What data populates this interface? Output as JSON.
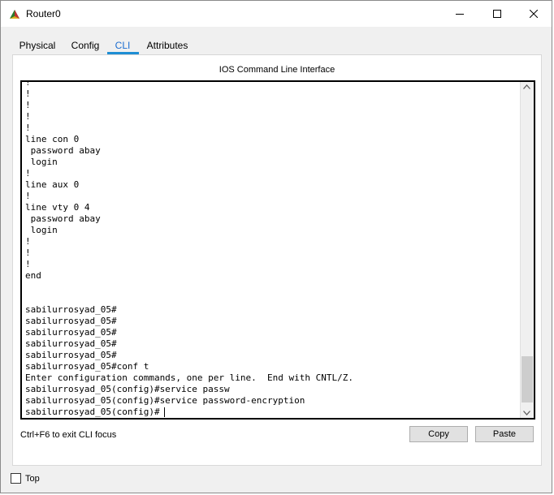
{
  "window": {
    "title": "Router0"
  },
  "tabs": [
    {
      "label": "Physical"
    },
    {
      "label": "Config"
    },
    {
      "label": "CLI",
      "active": true
    },
    {
      "label": "Attributes"
    }
  ],
  "cli": {
    "panel_title": "IOS Command Line Interface",
    "lines": [
      "!",
      "!",
      "!",
      "!",
      "!",
      "line con 0",
      " password abay",
      " login",
      "!",
      "line aux 0",
      "!",
      "line vty 0 4",
      " password abay",
      " login",
      "!",
      "!",
      "!",
      "end",
      "",
      "",
      "sabilurrosyad_05#",
      "sabilurrosyad_05#",
      "sabilurrosyad_05#",
      "sabilurrosyad_05#",
      "sabilurrosyad_05#",
      "sabilurrosyad_05#conf t",
      "Enter configuration commands, one per line.  End with CNTL/Z.",
      "sabilurrosyad_05(config)#service passw",
      "sabilurrosyad_05(config)#service password-encryption",
      "sabilurrosyad_05(config)#"
    ],
    "hint": "Ctrl+F6 to exit CLI focus",
    "copy_label": "Copy",
    "paste_label": "Paste"
  },
  "footer": {
    "top_label": "Top",
    "top_checked": false
  },
  "colors": {
    "accent": "#1e8ed4",
    "active_tab_text": "#1c6dd0"
  }
}
